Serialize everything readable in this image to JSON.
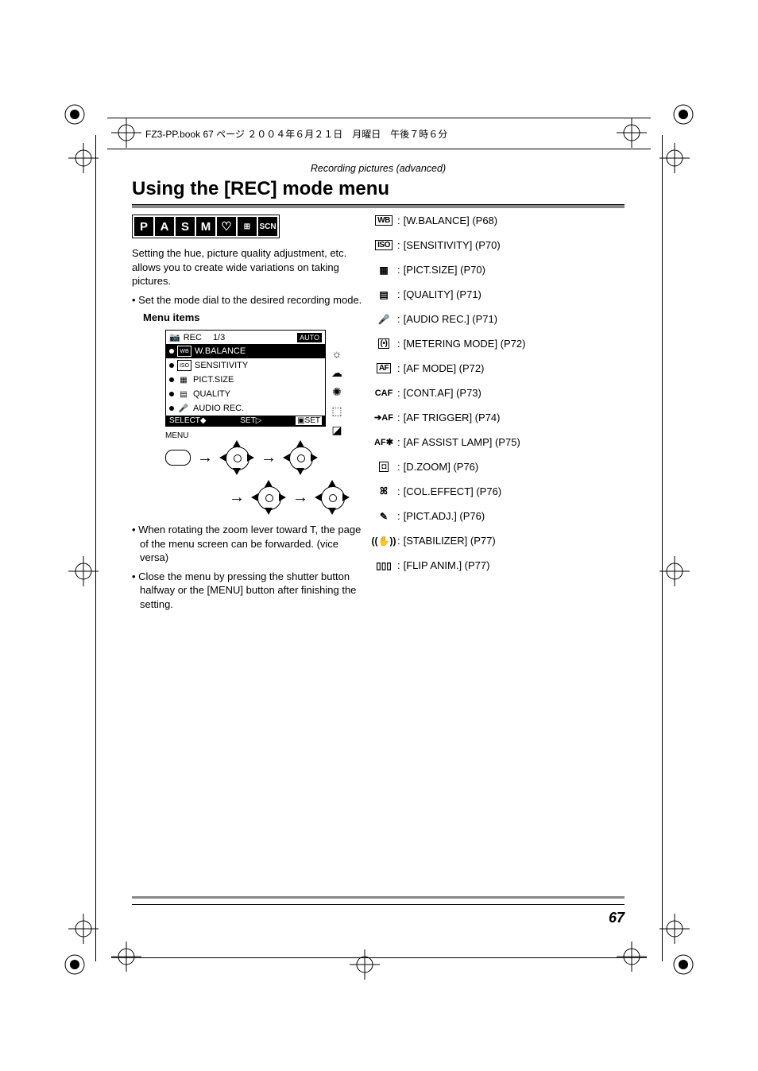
{
  "header": {
    "book_info": "FZ3-PP.book  67 ページ  ２００４年６月２１日　月曜日　午後７時６分"
  },
  "section_label": "Recording pictures (advanced)",
  "title": "Using the [REC] mode menu",
  "mode_icons": [
    "P",
    "A",
    "S",
    "M",
    "♡",
    "⊞",
    "SCN"
  ],
  "intro_text": "Setting the hue, picture quality adjustment, etc. allows you to create wide variations on taking pictures.",
  "bullets_top": [
    "Set the mode dial to the desired recording mode."
  ],
  "menu_heading": "Menu items",
  "menu_screen": {
    "top_label_icon": "📷",
    "top_label": "REC",
    "page_indicator": "1/3",
    "tab": "AUTO",
    "rows": [
      {
        "icon": "WB",
        "label": "W.BALANCE",
        "hl": true
      },
      {
        "icon": "ISO",
        "label": "SENSITIVITY",
        "hl": false
      },
      {
        "icon": "▦",
        "label": "PICT.SIZE",
        "hl": false
      },
      {
        "icon": "▤",
        "label": "QUALITY",
        "hl": false
      },
      {
        "icon": "🎤",
        "label": "AUDIO REC.",
        "hl": false
      }
    ],
    "side_icons": [
      "☼",
      "☁",
      "✺",
      "⬚",
      "◪"
    ],
    "bottom_left": "SELECT",
    "bottom_mid": "SET",
    "bottom_right": "SET"
  },
  "nav_label": "MENU",
  "bullets_bottom": [
    "When rotating the zoom lever toward T, the page of the menu screen can be forwarded. (vice versa)",
    "Close the menu by pressing the shutter button halfway or the [MENU] button after finishing the setting."
  ],
  "menu_items": [
    {
      "icon_type": "boxed",
      "icon": "WB",
      "label": "[W.BALANCE] (P68)"
    },
    {
      "icon_type": "boxed",
      "icon": "ISO",
      "label": "[SENSITIVITY] (P70)"
    },
    {
      "icon_type": "glyph",
      "icon": "▦",
      "label": "[PICT.SIZE] (P70)"
    },
    {
      "icon_type": "glyph",
      "icon": "▤",
      "label": "[QUALITY] (P71)"
    },
    {
      "icon_type": "glyph",
      "icon": "🎤",
      "label": "[AUDIO REC.] (P71)"
    },
    {
      "icon_type": "boxed",
      "icon": "(•)",
      "label": "[METERING MODE] (P72)"
    },
    {
      "icon_type": "boxed",
      "icon": "AF",
      "label": "[AF MODE] (P72)"
    },
    {
      "icon_type": "text",
      "icon": "CAF",
      "label": "[CONT.AF] (P73)"
    },
    {
      "icon_type": "text",
      "icon": "➔AF",
      "label": "[AF TRIGGER] (P74)"
    },
    {
      "icon_type": "text",
      "icon": "AF✱",
      "label": "[AF ASSIST LAMP] (P75)"
    },
    {
      "icon_type": "boxed",
      "icon": "◘",
      "label": "[D.ZOOM] (P76)"
    },
    {
      "icon_type": "glyph",
      "icon": "ꕤ",
      "label": "[COL.EFFECT] (P76)"
    },
    {
      "icon_type": "glyph",
      "icon": "✎",
      "label": "[PICT.ADJ.] (P76)"
    },
    {
      "icon_type": "glyph",
      "icon": "((✋))",
      "label": "[STABILIZER] (P77)"
    },
    {
      "icon_type": "glyph",
      "icon": "▯▯▯",
      "label": "[FLIP ANIM.] (P77)"
    }
  ],
  "page_number": "67"
}
